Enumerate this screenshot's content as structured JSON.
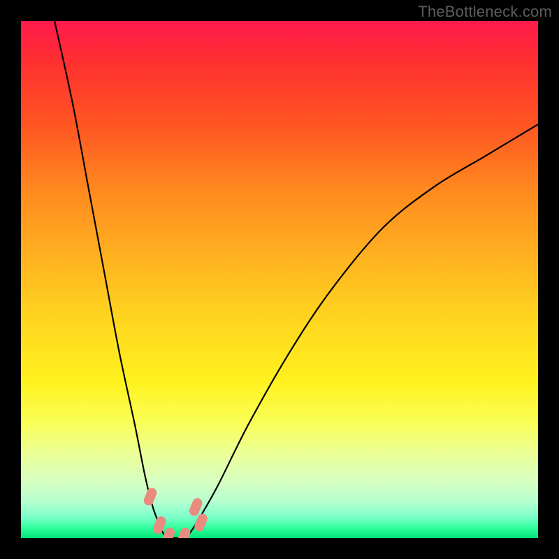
{
  "attribution": "TheBottleneck.com",
  "chart_data": {
    "type": "line",
    "title": "",
    "xlabel": "",
    "ylabel": "",
    "xlim": [
      0,
      100
    ],
    "ylim": [
      0,
      100
    ],
    "background_gradient": {
      "orientation": "vertical",
      "stops": [
        {
          "pos": 0.0,
          "color": "#ff1a4d"
        },
        {
          "pos": 0.08,
          "color": "#ff3030"
        },
        {
          "pos": 0.2,
          "color": "#ff5522"
        },
        {
          "pos": 0.33,
          "color": "#ff8a1f"
        },
        {
          "pos": 0.45,
          "color": "#ffb020"
        },
        {
          "pos": 0.58,
          "color": "#ffd61f"
        },
        {
          "pos": 0.7,
          "color": "#fff21f"
        },
        {
          "pos": 0.78,
          "color": "#f9ff5a"
        },
        {
          "pos": 0.84,
          "color": "#eaff9a"
        },
        {
          "pos": 0.89,
          "color": "#d6ffc0"
        },
        {
          "pos": 0.93,
          "color": "#b6ffd0"
        },
        {
          "pos": 0.96,
          "color": "#7affc9"
        },
        {
          "pos": 0.98,
          "color": "#32ff9e"
        },
        {
          "pos": 1.0,
          "color": "#00e676"
        }
      ]
    },
    "series": [
      {
        "name": "left-branch",
        "x": [
          6.5,
          10.0,
          13.0,
          16.0,
          19.0,
          22.0,
          24.0,
          25.5,
          27.0,
          28.0
        ],
        "y": [
          100.0,
          84.0,
          68.0,
          52.0,
          36.0,
          22.0,
          12.0,
          6.0,
          2.0,
          0.0
        ]
      },
      {
        "name": "right-branch",
        "x": [
          32.0,
          34.0,
          38.0,
          44.0,
          52.0,
          60.0,
          70.0,
          80.0,
          90.0,
          100.0
        ],
        "y": [
          0.0,
          3.0,
          10.0,
          22.0,
          36.0,
          48.0,
          60.0,
          68.0,
          74.0,
          80.0
        ]
      },
      {
        "name": "flat-bottom",
        "x": [
          28.0,
          32.0
        ],
        "y": [
          0.0,
          0.0
        ]
      }
    ],
    "markers": [
      {
        "name": "left-highlight-upper",
        "x": 25.0,
        "y": 8.0,
        "color": "#e98b7f"
      },
      {
        "name": "left-highlight-lower",
        "x": 26.8,
        "y": 2.5,
        "color": "#e98b7f"
      },
      {
        "name": "right-highlight-upper",
        "x": 33.8,
        "y": 6.0,
        "color": "#e98b7f"
      },
      {
        "name": "right-highlight-lower",
        "x": 34.8,
        "y": 3.0,
        "color": "#e98b7f"
      },
      {
        "name": "bottom-highlight-left",
        "x": 28.5,
        "y": 0.3,
        "color": "#e98b7f"
      },
      {
        "name": "bottom-highlight-right",
        "x": 31.5,
        "y": 0.3,
        "color": "#e98b7f"
      }
    ]
  }
}
